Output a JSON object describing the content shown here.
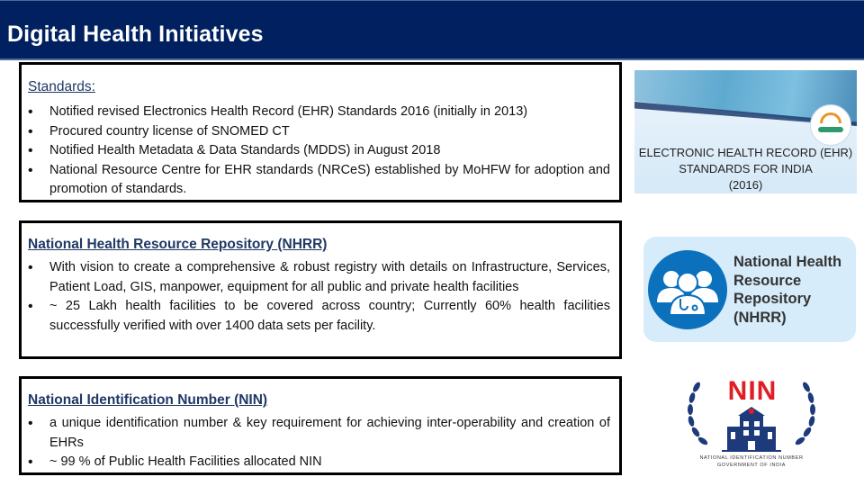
{
  "header": {
    "title": "Digital Health Initiatives"
  },
  "sections": [
    {
      "heading": "Standards:",
      "bullets": [
        "Notified  revised Electronics Health Record (EHR) Standards 2016 (initially in 2013)",
        "Procured country license of SNOMED CT",
        "Notified Health Metadata & Data Standards (MDDS) in August 2018",
        "National Resource Centre for EHR standards (NRCeS) established by MoHFW for adoption and promotion of standards."
      ]
    },
    {
      "heading": "National Health Resource Repository  (NHRR)",
      "bullets": [
        "With vision to create a comprehensive & robust registry with details on Infrastructure, Services, Patient Load, GIS, manpower, equipment for all public and private health facilities",
        "~ 25 Lakh  health facilities to be covered across country;  Currently 60% health facilities successfully verified with over 1400 data sets per facility."
      ]
    },
    {
      "heading": "National Identification Number (NIN)",
      "bullets": [
        "a unique identification number & key requirement for achieving inter-operability and creation of EHRs",
        "~ 99 % of Public Health Facilities allocated NIN"
      ]
    }
  ],
  "bullet_glyph": "•",
  "images": {
    "ehr": {
      "lines": [
        "ELECTRONIC HEALTH RECORD (EHR)",
        "STANDARDS FOR INDIA",
        "(2016)"
      ]
    },
    "nhrr": {
      "lines": [
        "National Health",
        "Resource",
        "Repository",
        "(NHRR)"
      ]
    },
    "nin": {
      "title": "NIN",
      "sub1": "NATIONAL IDENTIFICATION NUMBER",
      "sub2": "GOVERNMENT OF INDIA"
    }
  },
  "colors": {
    "header_bg": "#00205f",
    "heading": "#1f3864",
    "nhrr_blue": "#0b71bd",
    "nin_red": "#e01e25",
    "nin_navy": "#1d3a7a"
  }
}
